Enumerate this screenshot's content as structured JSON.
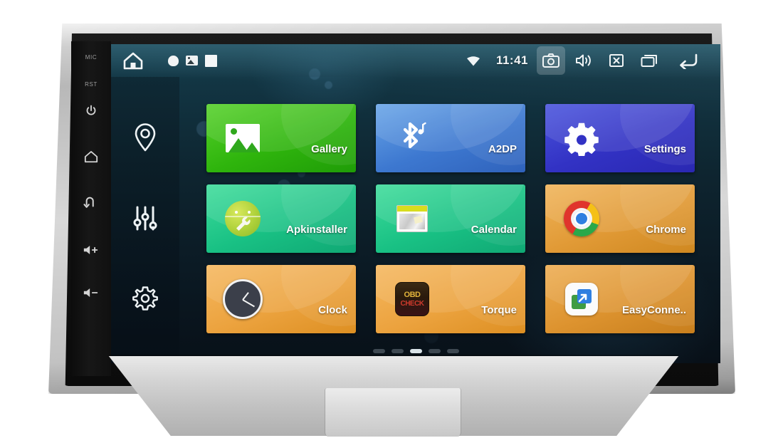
{
  "device": {
    "name": "car-android-head-unit",
    "bezel_keys": [
      {
        "id": "mic",
        "label": "MIC",
        "type": "text"
      },
      {
        "id": "rst",
        "label": "RST",
        "type": "text"
      },
      {
        "id": "power",
        "label": "",
        "type": "power-icon"
      },
      {
        "id": "home",
        "label": "",
        "type": "home-icon"
      },
      {
        "id": "back",
        "label": "",
        "type": "back-icon"
      },
      {
        "id": "vol-up",
        "label": "",
        "type": "volume-up-icon"
      },
      {
        "id": "vol-down",
        "label": "",
        "type": "volume-down-icon"
      }
    ]
  },
  "status_bar": {
    "home_icon": "home-icon",
    "notifications": [
      "droplet-icon",
      "image-icon",
      "square-icon"
    ],
    "wifi_icon": "wifi-icon",
    "time": "11:41",
    "items": [
      {
        "id": "camera",
        "icon": "camera-icon",
        "active": true
      },
      {
        "id": "volume",
        "icon": "volume-icon",
        "active": false
      },
      {
        "id": "close",
        "icon": "close-box-icon",
        "active": false
      },
      {
        "id": "recents",
        "icon": "recent-apps-icon",
        "active": false
      },
      {
        "id": "back",
        "icon": "back-arrow-icon",
        "active": false
      }
    ]
  },
  "nav_rail": {
    "items": [
      {
        "id": "navigation",
        "icon": "location-pin-icon"
      },
      {
        "id": "equalizer",
        "icon": "sliders-icon"
      },
      {
        "id": "settings",
        "icon": "gear-icon"
      }
    ]
  },
  "app_grid": {
    "tiles": [
      {
        "label": "Gallery",
        "icon": "gallery-icon",
        "color": "#2fb50d"
      },
      {
        "label": "A2DP",
        "icon": "bluetooth-audio-icon",
        "color": "#3d78d0"
      },
      {
        "label": "Settings",
        "icon": "gear-icon",
        "color": "#3232c4"
      },
      {
        "label": "Apkinstaller",
        "icon": "android-wrench-icon",
        "color": "#19c184"
      },
      {
        "label": "Calendar",
        "icon": "calendar-icon",
        "color": "#19c184"
      },
      {
        "label": "Chrome",
        "icon": "chrome-icon",
        "color": "#e19a36"
      },
      {
        "label": "Clock",
        "icon": "analog-clock-icon",
        "color": "#eca33f"
      },
      {
        "label": "Torque",
        "icon": "obd-check-icon",
        "color": "#eca33f"
      },
      {
        "label": "EasyConne..",
        "icon": "easyconnect-icon",
        "color": "#dd932f"
      }
    ]
  },
  "torque_icon_text": {
    "top": "OBD",
    "bottom": "CHECK"
  },
  "pagination": {
    "total": 5,
    "current": 3
  },
  "colors": {
    "screen_bg_top": "#1d4a58",
    "screen_bg_bottom": "#081018",
    "bezel_silver": "#cfcfcf",
    "status_active": "rgba(255,255,255,0.20)"
  }
}
